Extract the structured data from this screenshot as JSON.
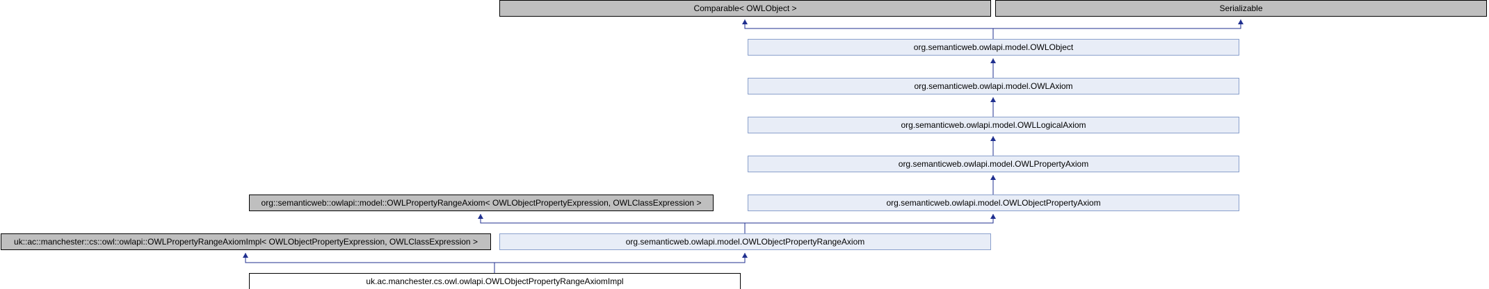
{
  "diagram": {
    "colors": {
      "external_fill": "#bfbfbf",
      "interface_fill": "#e8edf7",
      "interface_stroke": "#8aa0cc",
      "current_fill": "#ffffff",
      "edge": "#1f2f8f",
      "border": "#000000"
    },
    "nodes": [
      {
        "id": "comparable",
        "label": "Comparable< OWLObject >",
        "kind": "external"
      },
      {
        "id": "serializable",
        "label": "Serializable",
        "kind": "external"
      },
      {
        "id": "owlobject",
        "label": "org.semanticweb.owlapi.model.OWLObject",
        "kind": "interface"
      },
      {
        "id": "owlaxiom",
        "label": "org.semanticweb.owlapi.model.OWLAxiom",
        "kind": "interface"
      },
      {
        "id": "owllogicalaxiom",
        "label": "org.semanticweb.owlapi.model.OWLLogicalAxiom",
        "kind": "interface"
      },
      {
        "id": "owlpropertyaxiom",
        "label": "org.semanticweb.owlapi.model.OWLPropertyAxiom",
        "kind": "interface"
      },
      {
        "id": "propertyrangeaxiom_tmpl",
        "label": "org::semanticweb::owlapi::model::OWLPropertyRangeAxiom< OWLObjectPropertyExpression, OWLClassExpression >",
        "kind": "external"
      },
      {
        "id": "owlobjectpropertyaxiom",
        "label": "org.semanticweb.owlapi.model.OWLObjectPropertyAxiom",
        "kind": "interface"
      },
      {
        "id": "rangeaxiomimpl_tmpl",
        "label": "uk::ac::manchester::cs::owl::owlapi::OWLPropertyRangeAxiomImpl< OWLObjectPropertyExpression, OWLClassExpression >",
        "kind": "external"
      },
      {
        "id": "owlobjectpropertyrangeaxiom",
        "label": "org.semanticweb.owlapi.model.OWLObjectPropertyRangeAxiom",
        "kind": "interface"
      },
      {
        "id": "impl",
        "label": "uk.ac.manchester.cs.owl.owlapi.OWLObjectPropertyRangeAxiomImpl",
        "kind": "current"
      }
    ],
    "edges": [
      {
        "from": "owlobject",
        "to": "comparable"
      },
      {
        "from": "owlobject",
        "to": "serializable"
      },
      {
        "from": "owlaxiom",
        "to": "owlobject"
      },
      {
        "from": "owllogicalaxiom",
        "to": "owlaxiom"
      },
      {
        "from": "owlpropertyaxiom",
        "to": "owllogicalaxiom"
      },
      {
        "from": "owlobjectpropertyaxiom",
        "to": "owlpropertyaxiom"
      },
      {
        "from": "owlobjectpropertyrangeaxiom",
        "to": "propertyrangeaxiom_tmpl"
      },
      {
        "from": "owlobjectpropertyrangeaxiom",
        "to": "owlobjectpropertyaxiom"
      },
      {
        "from": "impl",
        "to": "rangeaxiomimpl_tmpl"
      },
      {
        "from": "impl",
        "to": "owlobjectpropertyrangeaxiom"
      }
    ]
  }
}
